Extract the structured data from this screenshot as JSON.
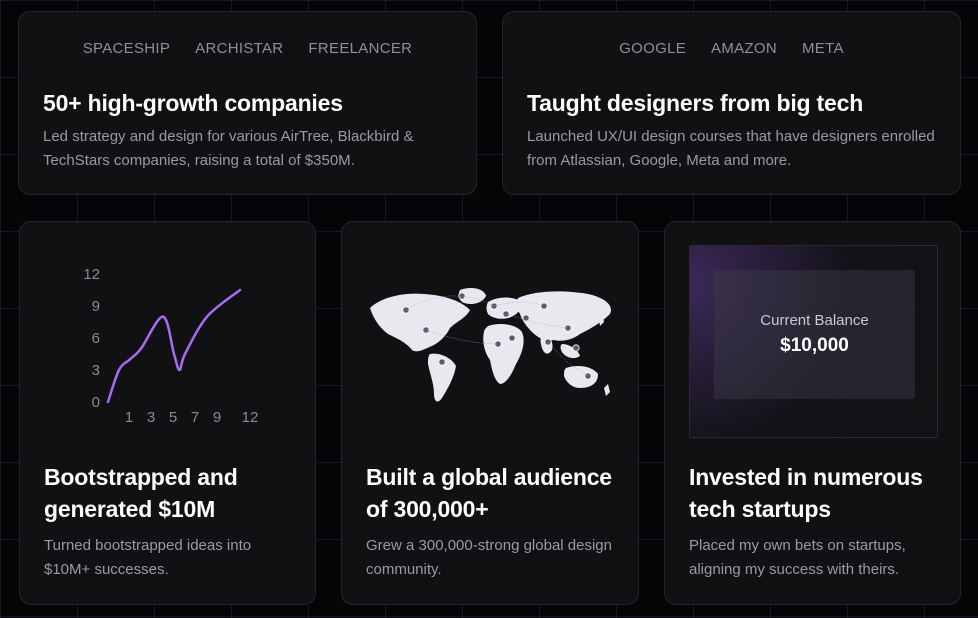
{
  "cards": {
    "companies": {
      "logos": [
        "SPACESHIP",
        "ARCHISTAR",
        "FREELANCER"
      ],
      "title": "50+ high-growth companies",
      "description": "Led strategy and design for various AirTree, Blackbird & TechStars companies, raising a total of $350M."
    },
    "big_tech": {
      "logos": [
        "GOOGLE",
        "AMAZON",
        "META"
      ],
      "title": "Taught designers from big tech",
      "description": "Launched UX/UI design courses that have designers enrolled from Atlassian, Google, Meta and more."
    },
    "bootstrapped": {
      "title": "Bootstrapped and generated $10M",
      "description": "Turned bootstrapped ideas into $10M+ successes."
    },
    "audience": {
      "title": "Built a global audience of 300,000+",
      "description": "Grew a 300,000-strong global design community."
    },
    "invested": {
      "title": "Invested in numerous tech startups",
      "description": "Placed my own bets on startups, aligning my success with theirs.",
      "balance_label": "Current Balance",
      "balance_value": "$10,000"
    }
  },
  "chart_data": {
    "type": "line",
    "x_ticks": [
      "1",
      "3",
      "5",
      "7",
      "9",
      "12"
    ],
    "y_ticks": [
      "0",
      "3",
      "6",
      "9",
      "12"
    ],
    "x": [
      0,
      1,
      2,
      3,
      5,
      6,
      6.5,
      7,
      9,
      12
    ],
    "y": [
      0,
      3,
      4,
      5,
      8,
      4.5,
      3,
      4.5,
      8,
      10.5
    ],
    "xlim": [
      0,
      12
    ],
    "ylim": [
      0,
      12
    ],
    "line_color": "#a86cf0",
    "title": "",
    "xlabel": "",
    "ylabel": ""
  },
  "theme": {
    "accent": "#a86cf0",
    "background": "#050507",
    "card": "#121216",
    "text_muted": "#9a9aa3"
  }
}
